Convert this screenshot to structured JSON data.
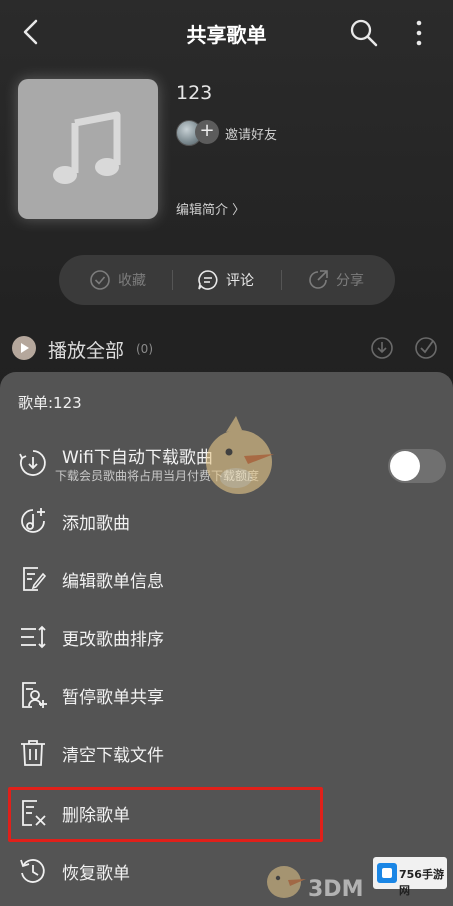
{
  "header": {
    "title": "共享歌单",
    "back_icon": "back-arrow-icon",
    "search_icon": "search-icon",
    "more_icon": "more-vertical-icon"
  },
  "playlist": {
    "cover_icon": "music-note-icon",
    "name": "123",
    "invite_label": "邀请好友",
    "edit_intro_label": "编辑简介 〉"
  },
  "actions": [
    {
      "label": "收藏",
      "icon": "check-circle-icon"
    },
    {
      "label": "评论",
      "icon": "comment-icon"
    },
    {
      "label": "分享",
      "icon": "share-icon"
    }
  ],
  "play_all": {
    "label": "播放全部",
    "count": "(0)"
  },
  "sheet": {
    "title": "歌单:123",
    "wifi": {
      "label": "Wifi下自动下载歌曲",
      "sub": "下载会员歌曲将占用当月付费下载额度",
      "toggle_on": false
    },
    "items": [
      {
        "label": "添加歌曲",
        "icon": "add-music-icon"
      },
      {
        "label": "编辑歌单信息",
        "icon": "edit-document-icon"
      },
      {
        "label": "更改歌曲排序",
        "icon": "sort-icon"
      },
      {
        "label": "暂停歌单共享",
        "icon": "pause-share-icon"
      },
      {
        "label": "清空下载文件",
        "icon": "trash-icon"
      },
      {
        "label": "删除歌单",
        "icon": "delete-list-icon"
      },
      {
        "label": "恢复歌单",
        "icon": "restore-icon"
      }
    ]
  },
  "watermarks": {
    "brand_a": "3DM",
    "brand_b": "756手游网"
  },
  "colors": {
    "sheet_bg": "#545454",
    "highlight_border": "#e0201a",
    "page_bg": "#1a1a1a"
  }
}
